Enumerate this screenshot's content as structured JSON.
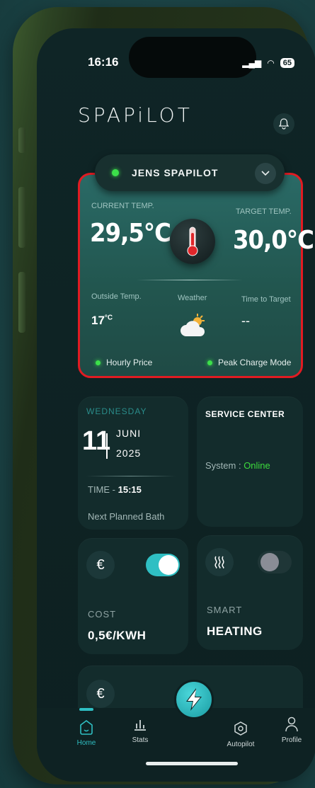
{
  "status": {
    "time": "16:16",
    "battery": "65"
  },
  "brand": "SPAPiLOT",
  "device": {
    "name": "JENS SPAPILOT"
  },
  "climate": {
    "current_label": "CURRENT TEMP.",
    "current_value": "29,5°C",
    "target_label": "TARGET TEMP.",
    "target_value": "30,0°C",
    "outside_label": "Outside Temp.",
    "outside_value": "17",
    "outside_unit": "°C",
    "weather_label": "Weather",
    "time_to_target_label": "Time to Target",
    "time_to_target_value": "--",
    "hourly_price": "Hourly Price",
    "peak_mode": "Peak Charge Mode"
  },
  "date_tile": {
    "weekday": "WEDNESDAY",
    "day": "11",
    "month": "JUNI",
    "year": "2025",
    "time_label": "TIME",
    "time_value": "15:15",
    "next_bath": "Next Planned Bath"
  },
  "service": {
    "title": "SERVICE CENTER",
    "status_label": "System : ",
    "status_value": "Online"
  },
  "cost_tile": {
    "icon": "€",
    "caption": "COST",
    "value": "0,5€/KWH",
    "toggle_on": true
  },
  "heating_tile": {
    "caption": "SMART",
    "value": "HEATING",
    "toggle_on": false
  },
  "extra_tile": {
    "icon": "€"
  },
  "nav": {
    "home": "Home",
    "stats": "Stats",
    "autopilot": "Autopilot",
    "profile": "Profile"
  },
  "colors": {
    "accent": "#2fbfc3",
    "alert_border": "#e11b22",
    "online": "#3ddc3d"
  }
}
